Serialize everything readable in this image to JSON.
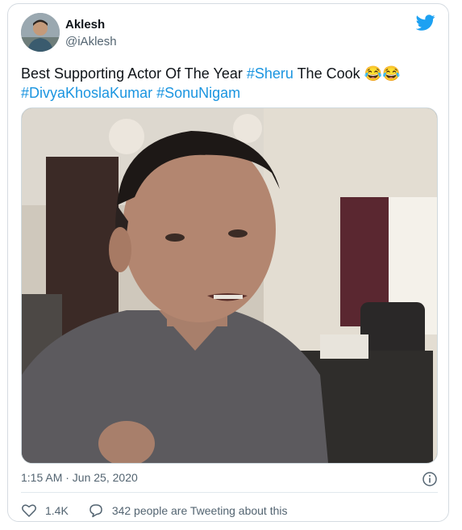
{
  "user": {
    "name": "Aklesh",
    "handle": "@iAklesh",
    "avatar_icon": "user-avatar"
  },
  "tweet": {
    "text_prefix": "Best Supporting Actor Of The Year ",
    "tag1": "#Sheru",
    "text_mid": " The Cook ",
    "emoji": "😂😂",
    "tag2": "#DivyaKhoslaKumar",
    "tag3": "#SonuNigam"
  },
  "meta": {
    "timestamp": "1:15 AM · Jun 25, 2020"
  },
  "actions": {
    "likes": "1.4K",
    "tweeting": "342 people are Tweeting about this"
  },
  "colors": {
    "link": "#1b95e0",
    "twitter_blue": "#1da1f2",
    "muted": "#536471"
  }
}
